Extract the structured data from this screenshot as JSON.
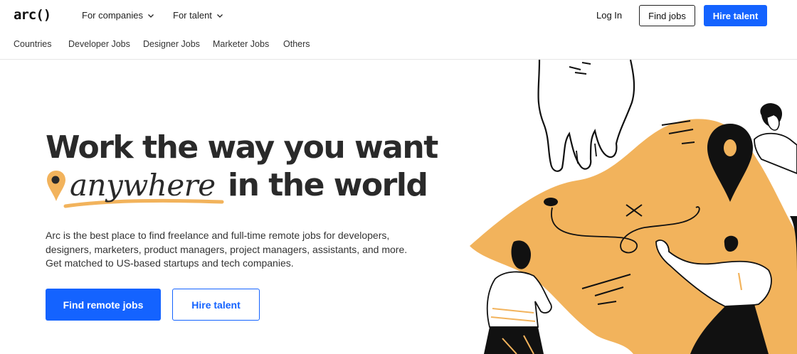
{
  "header": {
    "logo": "arc()",
    "nav": [
      {
        "label": "For companies"
      },
      {
        "label": "For talent"
      }
    ],
    "login": "Log In",
    "find_jobs": "Find jobs",
    "hire_talent": "Hire talent"
  },
  "subnav": {
    "items": [
      "Countries",
      "Developer Jobs",
      "Designer Jobs",
      "Marketer Jobs",
      "Others"
    ]
  },
  "hero": {
    "title_line1": "Work the way you want",
    "title_accent": "anywhere",
    "title_line2_rest": "in the world",
    "description": "Arc is the best place to find freelance and full-time remote jobs for developers, designers, marketers, product managers, project managers, assistants, and more. Get matched to US-based startups and tech companies.",
    "primary_cta": "Find remote jobs",
    "secondary_cta": "Hire talent"
  },
  "colors": {
    "brand_blue": "#1463ff",
    "accent_orange": "#f2b35c",
    "text_dark": "#2a2a2a"
  }
}
